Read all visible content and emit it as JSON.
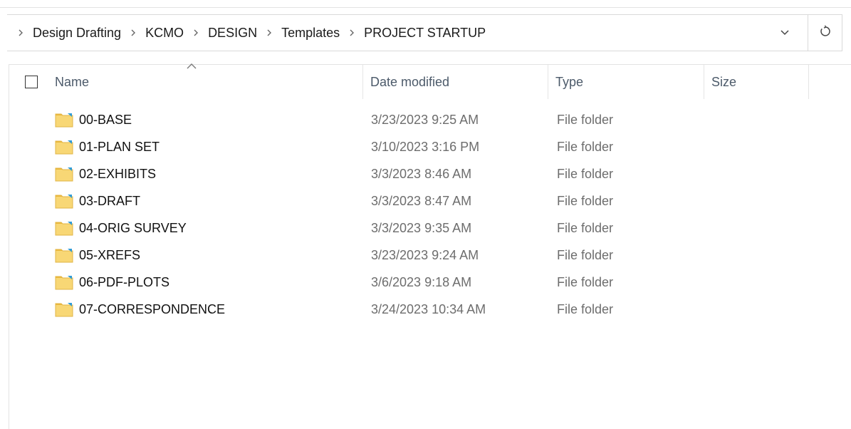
{
  "breadcrumb": {
    "items": [
      "Design Drafting",
      "KCMO",
      "DESIGN",
      "Templates",
      "PROJECT STARTUP"
    ]
  },
  "icons": {
    "separator": "chevron-right-icon",
    "history_dropdown": "chevron-down-icon",
    "refresh": "refresh-icon",
    "folder": "folder-icon",
    "sort": "sort-ascending-caret-icon"
  },
  "columns": {
    "name": "Name",
    "date_modified": "Date modified",
    "type": "Type",
    "size": "Size"
  },
  "files": [
    {
      "name": "00-BASE",
      "date": "3/23/2023 9:25 AM",
      "type": "File folder",
      "size": ""
    },
    {
      "name": "01-PLAN SET",
      "date": "3/10/2023 3:16 PM",
      "type": "File folder",
      "size": ""
    },
    {
      "name": "02-EXHIBITS",
      "date": "3/3/2023 8:46 AM",
      "type": "File folder",
      "size": ""
    },
    {
      "name": "03-DRAFT",
      "date": "3/3/2023 8:47 AM",
      "type": "File folder",
      "size": ""
    },
    {
      "name": "04-ORIG SURVEY",
      "date": "3/3/2023 9:35 AM",
      "type": "File folder",
      "size": ""
    },
    {
      "name": "05-XREFS",
      "date": "3/23/2023 9:24 AM",
      "type": "File folder",
      "size": ""
    },
    {
      "name": "06-PDF-PLOTS",
      "date": "3/6/2023 9:18 AM",
      "type": "File folder",
      "size": ""
    },
    {
      "name": "07-CORRESPONDENCE",
      "date": "3/24/2023 10:34 AM",
      "type": "File folder",
      "size": ""
    }
  ],
  "colors": {
    "folder_body": "#f8d775",
    "folder_tab": "#e8b73f",
    "folder_accent": "#2f9bd6",
    "header_text": "#4c5a6a",
    "meta_text": "#6d6d6d"
  }
}
